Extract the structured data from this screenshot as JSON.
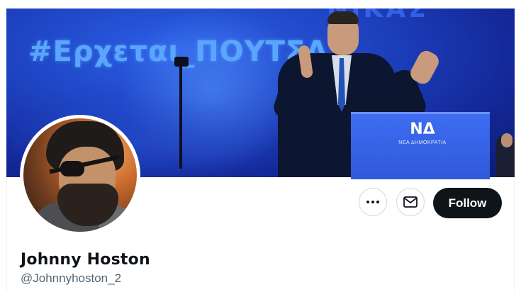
{
  "banner": {
    "hashtag_text": "#Ερχεται_ΠΟΥΤΣΑ",
    "partial_top_text": "ΝΙΚΑΣ",
    "podium_logo": "ΝΔ",
    "podium_subtext": "ΝΕΑ ΔΗΜΟΚΡΑΤΙΑ",
    "background_color": "#1f46c6"
  },
  "profile": {
    "display_name": "Johnny Hoston",
    "handle": "@Johnnyhoston_2",
    "avatar_description_icon": "avatar"
  },
  "actions": {
    "more_icon": "more-icon",
    "message_icon": "envelope-icon",
    "follow_label": "Follow",
    "follow_color": "#0f1419"
  }
}
